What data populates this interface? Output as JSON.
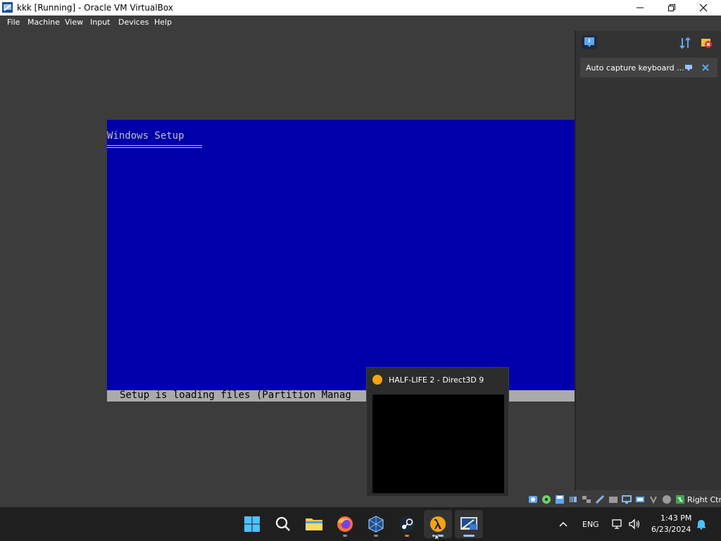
{
  "window": {
    "title": "kkk [Running] - Oracle VM VirtualBox"
  },
  "menu": {
    "file": "File",
    "machine": "Machine",
    "view": "View",
    "input": "Input",
    "devices": "Devices",
    "help": "Help"
  },
  "vm_screen": {
    "setup_title": "Windows Setup",
    "status_text": "Setup is loading files (Partition Manag",
    "colors": {
      "background": "#0000aa",
      "text": "#c0c0c0",
      "status_bar": "#aaaaaa"
    }
  },
  "side_panel": {
    "notice_text": "Auto capture keyboard ..."
  },
  "status_bar": {
    "host_key": "Right Ctrl"
  },
  "popup": {
    "title": "HALF-LIFE 2 - Direct3D 9"
  },
  "taskbar": {
    "apps": [
      "start-icon",
      "search-icon",
      "file-explorer-icon",
      "firefox-icon",
      "virtualbox-icon",
      "steam-icon",
      "half-life-2-icon",
      "virtualbox-vm-xp-icon"
    ],
    "language": "ENG",
    "time": "1:43 PM",
    "date": "6/23/2024"
  }
}
